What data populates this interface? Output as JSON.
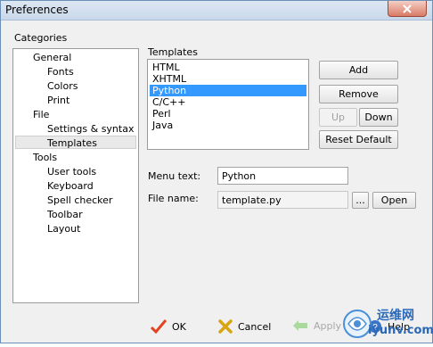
{
  "window": {
    "title": "Preferences"
  },
  "categories": {
    "label": "Categories",
    "items": [
      {
        "label": "General"
      },
      {
        "label": "Fonts"
      },
      {
        "label": "Colors"
      },
      {
        "label": "Print"
      },
      {
        "label": "File"
      },
      {
        "label": "Settings & syntax"
      },
      {
        "label": "Templates",
        "selected": true
      },
      {
        "label": "Tools"
      },
      {
        "label": "User tools"
      },
      {
        "label": "Keyboard"
      },
      {
        "label": "Spell checker"
      },
      {
        "label": "Toolbar"
      },
      {
        "label": "Layout"
      }
    ]
  },
  "templates": {
    "label": "Templates",
    "items": [
      "HTML",
      "XHTML",
      "Python",
      "C/C++",
      "Perl",
      "Java"
    ],
    "selected": "Python"
  },
  "buttons": {
    "add": "Add",
    "remove": "Remove",
    "up": "Up",
    "down": "Down",
    "reset_default": "Reset Default",
    "browse": "...",
    "open": "Open"
  },
  "fields": {
    "menu_text_label": "Menu text:",
    "menu_text_value": "Python",
    "file_name_label": "File name:",
    "file_name_value": "template.py"
  },
  "footer": {
    "ok": "OK",
    "cancel": "Cancel",
    "apply": "Apply",
    "help": "Help"
  },
  "watermark": {
    "line1": "运维网",
    "line2": "iyunv.com"
  },
  "colors": {
    "selection": "#3399ff",
    "ok_check": "#e3441f",
    "cancel_x": "#d8a412",
    "apply_arrow": "#8ccf7e"
  }
}
